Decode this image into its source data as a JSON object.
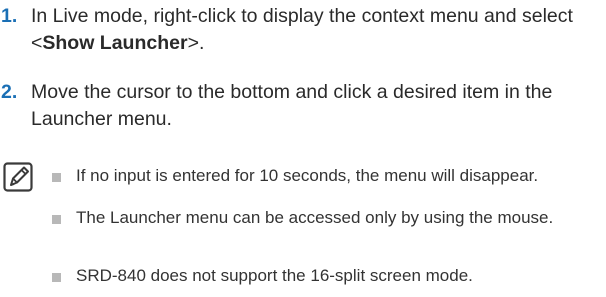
{
  "steps": [
    {
      "number": "1.",
      "text_before": "In Live mode, right-click to display the context menu and select <",
      "bold": "Show Launcher",
      "text_after": ">."
    },
    {
      "number": "2.",
      "text": "Move the cursor to the bottom and click a desired item in the Launcher menu."
    }
  ],
  "note": {
    "icon": "note-pencil-icon",
    "items": [
      "If no input is entered for 10 seconds, the menu will disappear.",
      "The Launcher menu can be accessed only by using the mouse.",
      "SRD-840 does not support the 16-split screen mode."
    ]
  },
  "colors": {
    "step_number": "#1a6fb5",
    "bullet": "#b8b8b8",
    "text": "#2a2a2a"
  }
}
